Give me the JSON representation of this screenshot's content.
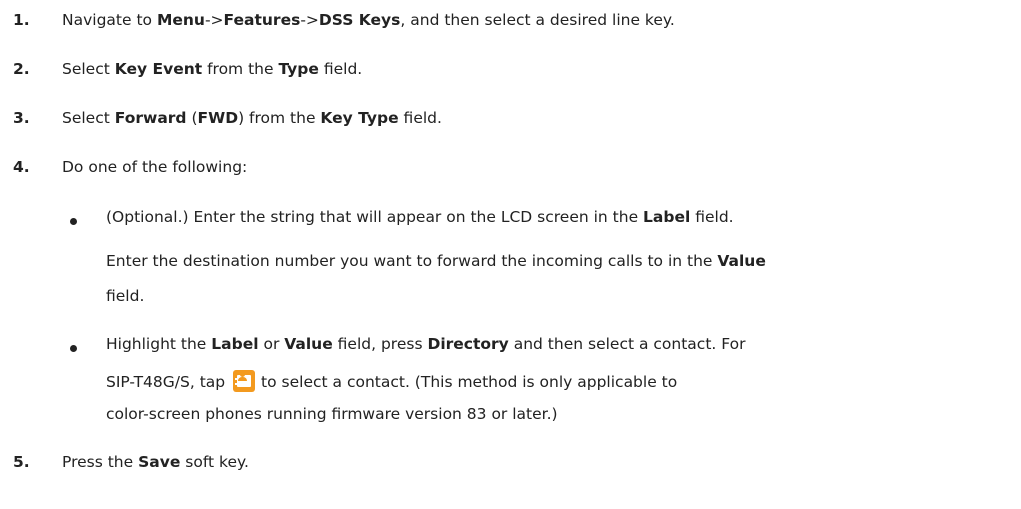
{
  "steps": [
    {
      "num": "1.",
      "parts": [
        "Navigate to ",
        "Menu",
        "->",
        "Features",
        "->",
        "DSS Keys",
        ", and then select a desired line key."
      ]
    },
    {
      "num": "2.",
      "parts": [
        "Select ",
        "Key Event",
        " from the ",
        "Type",
        " field."
      ]
    },
    {
      "num": "3.",
      "parts": [
        "Select ",
        "Forward",
        " (",
        "FWD",
        ") from the ",
        "Key Type",
        " field."
      ]
    },
    {
      "num": "4.",
      "text": "Do one of the following:"
    },
    {
      "num": "5.",
      "parts": [
        "Press the ",
        "Save",
        " soft key."
      ]
    }
  ],
  "options": [
    {
      "line1": [
        "(Optional.) Enter the string that will appear on the LCD screen in the ",
        "Label",
        " field."
      ],
      "line2": [
        "Enter the destination number you want to forward the incoming calls to in the ",
        "Value"
      ],
      "line3": "field."
    },
    {
      "line1": [
        "Highlight the ",
        "Label",
        " or ",
        "Value",
        " field, press ",
        "Directory",
        " and then select a contact. For"
      ],
      "line2": [
        "SIP-T48G/S, tap ",
        "to select a contact. (This method is only applicable to"
      ],
      "line3": "color-screen phones running firmware version 83 or later.)",
      "icon": "contacts-icon"
    }
  ],
  "colors": {
    "text": "#222222",
    "icon_background": "#f39a1f"
  }
}
